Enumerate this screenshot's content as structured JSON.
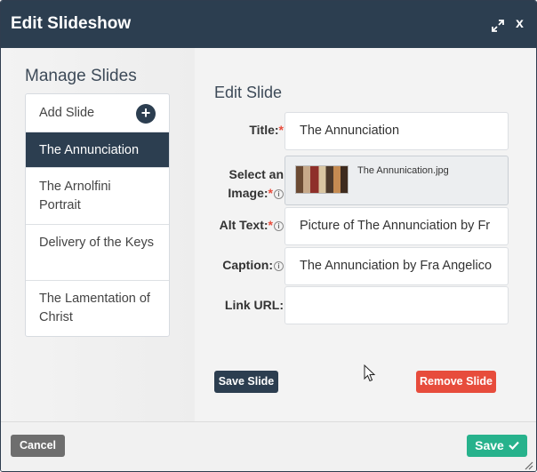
{
  "window": {
    "title": "Edit Slideshow",
    "close_label": "x"
  },
  "sidebar": {
    "heading": "Manage Slides",
    "add_label": "Add Slide",
    "add_icon": "+",
    "items": [
      {
        "label": "The Annunciation",
        "active": true
      },
      {
        "label": "The Arnolfini Portrait",
        "active": false
      },
      {
        "label": "Delivery of the Keys",
        "active": false
      },
      {
        "label": "The Lamentation of Christ",
        "active": false
      }
    ]
  },
  "editor": {
    "heading": "Edit Slide",
    "title_label": "Title:",
    "title_value": "The Annunciation",
    "image_label_line1": "Select an",
    "image_label_line2": "Image:",
    "image_filename": "The Annunication.jpg",
    "alt_label": "Alt Text:",
    "alt_value": "Picture of The Annunciation by Fr",
    "caption_label": "Caption:",
    "caption_value": "The Annunciation by Fra Angelico",
    "link_label": "Link URL:",
    "link_value": "",
    "required_mark": "*",
    "info_mark": "i",
    "save_slide_label": "Save Slide",
    "remove_slide_label": "Remove Slide"
  },
  "footer": {
    "cancel_label": "Cancel",
    "save_label": "Save"
  },
  "colors": {
    "header": "#2c3e50",
    "danger": "#e74c3c",
    "success": "#27b28c",
    "neutral": "#6e6e6e"
  }
}
